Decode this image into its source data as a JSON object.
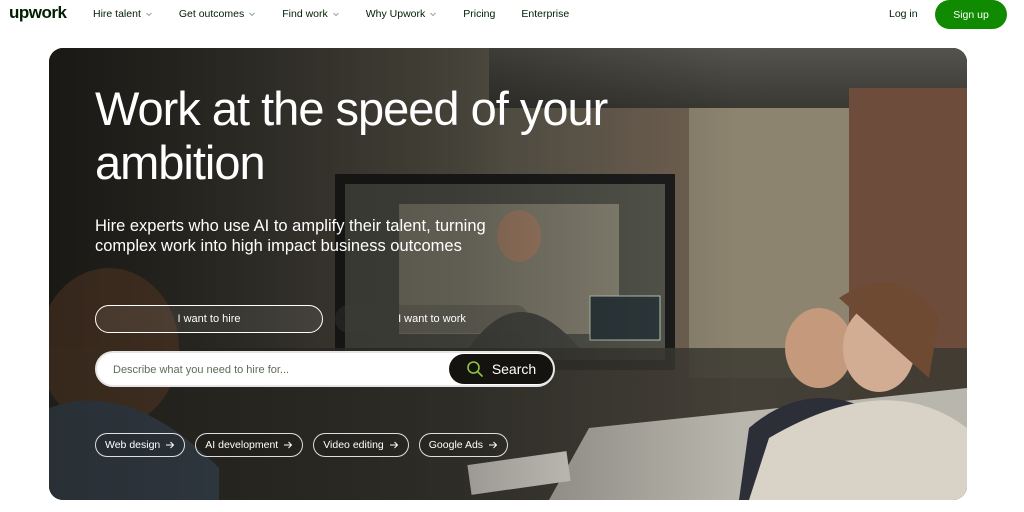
{
  "header": {
    "logo": "upwork",
    "nav": [
      {
        "label": "Hire talent",
        "icon": "chevron-down-icon"
      },
      {
        "label": "Get outcomes",
        "icon": "chevron-down-icon"
      },
      {
        "label": "Find work",
        "icon": "chevron-down-icon"
      },
      {
        "label": "Why Upwork",
        "icon": "chevron-down-icon"
      },
      {
        "label": "Pricing"
      },
      {
        "label": "Enterprise"
      }
    ],
    "login_label": "Log in",
    "signup_label": "Sign up"
  },
  "hero": {
    "title": "Work at the speed of your ambition",
    "subtitle": "Hire experts who use AI to amplify their talent, turning complex work into high impact business outcomes",
    "toggle": {
      "hire_label": "I want to hire",
      "work_label": "I want to work",
      "selected": "I want to hire"
    },
    "search": {
      "placeholder": "Describe what you need to hire for...",
      "button_label": "Search",
      "button_icon": "search-icon"
    },
    "chips": [
      {
        "label": "Web design",
        "icon": "arrow-right-icon"
      },
      {
        "label": "AI development",
        "icon": "arrow-right-icon"
      },
      {
        "label": "Video editing",
        "icon": "arrow-right-icon"
      },
      {
        "label": "Google Ads",
        "icon": "arrow-right-icon"
      }
    ]
  },
  "colors": {
    "brand_green": "#108a00",
    "text_dark": "#001e00",
    "search_button": "#14130f",
    "search_icon_ring": "#8dc63f"
  }
}
